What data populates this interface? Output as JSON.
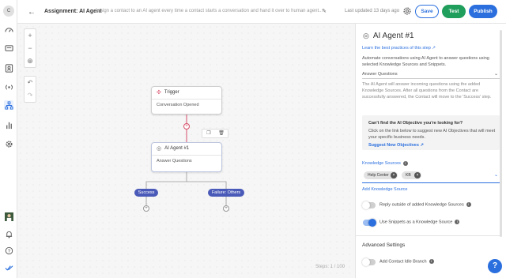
{
  "nav": {
    "avatar_initial": "C"
  },
  "header": {
    "title": "Assignment: AI Agent",
    "description": "Assign a contact to an AI agent every time a contact starts a conversation and hand it over to human agent...",
    "updated": "Last updated 13 days ago",
    "save_label": "Save",
    "test_label": "Test",
    "publish_label": "Publish"
  },
  "canvas": {
    "trigger_title": "Trigger",
    "trigger_body": "Conversation Opened",
    "agent_title": "AI Agent #1",
    "agent_body": "Answer Questions",
    "branch_success": "Success",
    "branch_failure": "Failure: Others",
    "steps": "Steps: 1 / 100"
  },
  "panel": {
    "title": "AI Agent #1",
    "learn_link": "Learn the best practices of this step",
    "intro": "Automate conversations using AI Agent to answer questions using selected Knowledge Sources and Snippets.",
    "objective_value": "Answer Questions",
    "objective_desc": "The AI Agent will answer incoming questions using the added Knowledge Sources. After all questions from the Contact are successfully answered, the Contact will move to the 'Success' step.",
    "box_title": "Can't find the AI Objective you're looking for?",
    "box_text": "Click on the link below to suggest new AI Objectives that will meet your specific business needs.",
    "box_link": "Suggest New Objectives",
    "ks_label": "Knowledge Sources",
    "chips": [
      "Help Center",
      "KB"
    ],
    "add_ks": "Add Knowledge Source",
    "toggle_reply": "Reply outside of added Knowledge Sources",
    "toggle_snippets": "Use Snippets as a Knowledge Source",
    "advanced": "Advanced Settings",
    "toggle_idle": "Add Contact Idle Branch",
    "help": "?"
  },
  "colors": {
    "primary": "#2b6fde",
    "success": "#1f9e5c",
    "connector": "#d64e6a",
    "branch": "#4a5ab8"
  }
}
